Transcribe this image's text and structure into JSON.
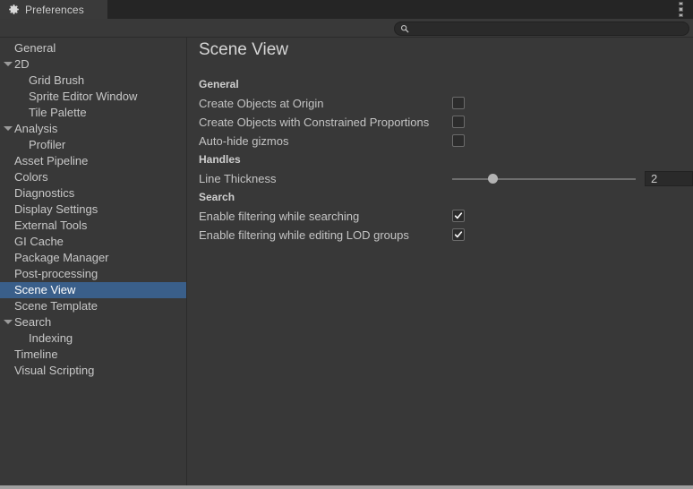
{
  "window": {
    "tab_label": "Preferences",
    "gear_icon": "gear-icon",
    "menu_icon": "kebab-menu-icon"
  },
  "search": {
    "value": "",
    "placeholder": "",
    "icon": "search-icon"
  },
  "sidebar": {
    "items": [
      {
        "label": "General",
        "depth": 0,
        "expandable": false,
        "selected": false
      },
      {
        "label": "2D",
        "depth": 0,
        "expandable": true,
        "selected": false
      },
      {
        "label": "Grid Brush",
        "depth": 1,
        "expandable": false,
        "selected": false
      },
      {
        "label": "Sprite Editor Window",
        "depth": 1,
        "expandable": false,
        "selected": false
      },
      {
        "label": "Tile Palette",
        "depth": 1,
        "expandable": false,
        "selected": false
      },
      {
        "label": "Analysis",
        "depth": 0,
        "expandable": true,
        "selected": false
      },
      {
        "label": "Profiler",
        "depth": 1,
        "expandable": false,
        "selected": false
      },
      {
        "label": "Asset Pipeline",
        "depth": 0,
        "expandable": false,
        "selected": false
      },
      {
        "label": "Colors",
        "depth": 0,
        "expandable": false,
        "selected": false
      },
      {
        "label": "Diagnostics",
        "depth": 0,
        "expandable": false,
        "selected": false
      },
      {
        "label": "Display Settings",
        "depth": 0,
        "expandable": false,
        "selected": false
      },
      {
        "label": "External Tools",
        "depth": 0,
        "expandable": false,
        "selected": false
      },
      {
        "label": "GI Cache",
        "depth": 0,
        "expandable": false,
        "selected": false
      },
      {
        "label": "Package Manager",
        "depth": 0,
        "expandable": false,
        "selected": false
      },
      {
        "label": "Post-processing",
        "depth": 0,
        "expandable": false,
        "selected": false
      },
      {
        "label": "Scene View",
        "depth": 0,
        "expandable": false,
        "selected": true
      },
      {
        "label": "Scene Template",
        "depth": 0,
        "expandable": false,
        "selected": false
      },
      {
        "label": "Search",
        "depth": 0,
        "expandable": true,
        "selected": false
      },
      {
        "label": "Indexing",
        "depth": 1,
        "expandable": false,
        "selected": false
      },
      {
        "label": "Timeline",
        "depth": 0,
        "expandable": false,
        "selected": false
      },
      {
        "label": "Visual Scripting",
        "depth": 0,
        "expandable": false,
        "selected": false
      }
    ],
    "selection_color": "#3a5f8a"
  },
  "content": {
    "title": "Scene View",
    "sections": [
      {
        "header": "General",
        "rows": [
          {
            "type": "checkbox",
            "label": "Create Objects at Origin",
            "checked": false
          },
          {
            "type": "checkbox",
            "label": "Create Objects with Constrained Proportions",
            "checked": false
          },
          {
            "type": "checkbox",
            "label": "Auto-hide gizmos",
            "checked": false
          }
        ]
      },
      {
        "header": "Handles",
        "rows": [
          {
            "type": "slider",
            "label": "Line Thickness",
            "value": "2",
            "fill_percent": 22
          }
        ]
      },
      {
        "header": "Search",
        "rows": [
          {
            "type": "checkbox",
            "label": "Enable filtering while searching",
            "checked": true
          },
          {
            "type": "checkbox",
            "label": "Enable filtering while editing LOD groups",
            "checked": true
          }
        ]
      }
    ]
  },
  "theme": {
    "background": "#383838",
    "titlebar": "#252525",
    "tab": "#3a3a3a",
    "text": "#c4c4c4",
    "accent": "#3a5f8a"
  }
}
